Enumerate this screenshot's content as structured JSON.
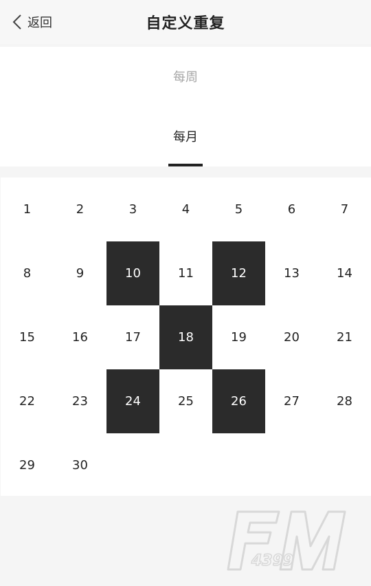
{
  "header": {
    "back_label": "返回",
    "title": "自定义重复"
  },
  "repeat_options": {
    "weekly": "每周",
    "monthly": "每月",
    "selected": "monthly"
  },
  "calendar": {
    "days": [
      "1",
      "2",
      "3",
      "4",
      "5",
      "6",
      "7",
      "8",
      "9",
      "10",
      "11",
      "12",
      "13",
      "14",
      "15",
      "16",
      "17",
      "18",
      "19",
      "20",
      "21",
      "22",
      "23",
      "24",
      "25",
      "26",
      "27",
      "28",
      "29",
      "30"
    ],
    "selected_days": [
      "10",
      "12",
      "18",
      "24",
      "26"
    ]
  },
  "watermark": {
    "brand": "FM",
    "number": "4399"
  },
  "colors": {
    "selected_bg": "#2b2b2b",
    "selected_text": "#ffffff",
    "inactive_option": "#a6a6a6",
    "page_bg": "#f5f5f5"
  }
}
